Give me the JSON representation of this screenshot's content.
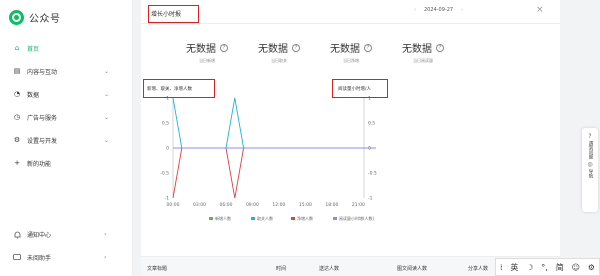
{
  "app": {
    "name": "公众号"
  },
  "sidebar": {
    "items": [
      {
        "label": "首页",
        "icon": "home-icon",
        "glyph": "⌂"
      },
      {
        "label": "内容与互动",
        "icon": "document-icon",
        "glyph": "▤"
      },
      {
        "label": "数据",
        "icon": "chart-icon",
        "glyph": "◔"
      },
      {
        "label": "广告与服务",
        "icon": "ad-icon",
        "glyph": "◷"
      },
      {
        "label": "设置与开发",
        "icon": "gear-icon",
        "glyph": "⚙"
      },
      {
        "label": "新的功能",
        "icon": "plus-icon",
        "glyph": "+"
      }
    ],
    "bottom": [
      {
        "label": "通知中心",
        "icon": "bell-icon",
        "glyph": "🔔"
      },
      {
        "label": "未阅助手",
        "icon": "message-icon",
        "glyph": "✉"
      }
    ]
  },
  "panel": {
    "title": "增长小时报",
    "date": "2024-09-27",
    "stats": [
      {
        "value": "无数据",
        "label": "当日新增"
      },
      {
        "value": "无数据",
        "label": "当日取关"
      },
      {
        "value": "无数据",
        "label": "当日净增"
      },
      {
        "value": "无数据",
        "label": "当日阅读量"
      }
    ],
    "left_axis_tag": "新增、取关、净增人数",
    "right_axis_tag": "阅读量小时增/人",
    "table_headers": [
      "文章标题",
      "时间",
      "送达人数",
      "图文阅读人数",
      "分享人数"
    ]
  },
  "chart_data": {
    "type": "line",
    "x": [
      "00:00",
      "01:00",
      "02:00",
      "03:00",
      "04:00",
      "05:00",
      "06:00",
      "07:00",
      "08:00",
      "09:00",
      "10:00",
      "11:00",
      "12:00",
      "13:00",
      "14:00",
      "15:00",
      "16:00",
      "17:00",
      "18:00",
      "19:00",
      "20:00",
      "21:00",
      "22:00",
      "23:00"
    ],
    "xticks": [
      "00:00",
      "03:00",
      "06:00",
      "09:00",
      "12:00",
      "15:00",
      "18:00",
      "21:00"
    ],
    "ylim": [
      -1,
      1
    ],
    "yticks": [
      -1,
      -0.5,
      0,
      0.5,
      1
    ],
    "y2ticks": [
      -1,
      -0.5,
      0,
      0.5,
      1
    ],
    "series": [
      {
        "name": "新增人数",
        "color": "#5cb85c",
        "values": [
          0,
          0,
          0,
          0,
          0,
          0,
          0,
          0,
          0,
          0,
          0,
          0,
          0,
          0,
          0,
          0,
          0,
          0,
          0,
          0,
          0,
          0,
          0,
          0
        ]
      },
      {
        "name": "取关人数",
        "color": "#1bb5d6",
        "values": [
          1,
          0,
          0,
          0,
          0,
          0,
          0,
          1,
          0,
          0,
          0,
          0,
          0,
          0,
          0,
          0,
          0,
          0,
          0,
          0,
          0,
          0,
          0,
          0
        ]
      },
      {
        "name": "净增人数",
        "color": "#e04040",
        "values": [
          -1,
          0,
          0,
          0,
          0,
          0,
          0,
          -1,
          0,
          0,
          0,
          0,
          0,
          0,
          0,
          0,
          0,
          0,
          0,
          0,
          0,
          0,
          0,
          0
        ]
      },
      {
        "name": "阅读量小时增(人数)",
        "color": "#8c8cf0",
        "values": [
          0,
          0,
          0,
          0,
          0,
          0,
          0,
          0,
          0,
          0,
          0,
          0,
          0,
          0,
          0,
          0,
          0,
          0,
          0,
          0,
          0,
          0,
          0,
          0
        ]
      }
    ]
  },
  "float_card": {
    "items": [
      {
        "label": "遇到问题",
        "icon": "help-icon"
      },
      {
        "label": "导航",
        "icon": "compass-icon"
      }
    ]
  },
  "ime": {
    "items": [
      "英",
      "简"
    ]
  }
}
